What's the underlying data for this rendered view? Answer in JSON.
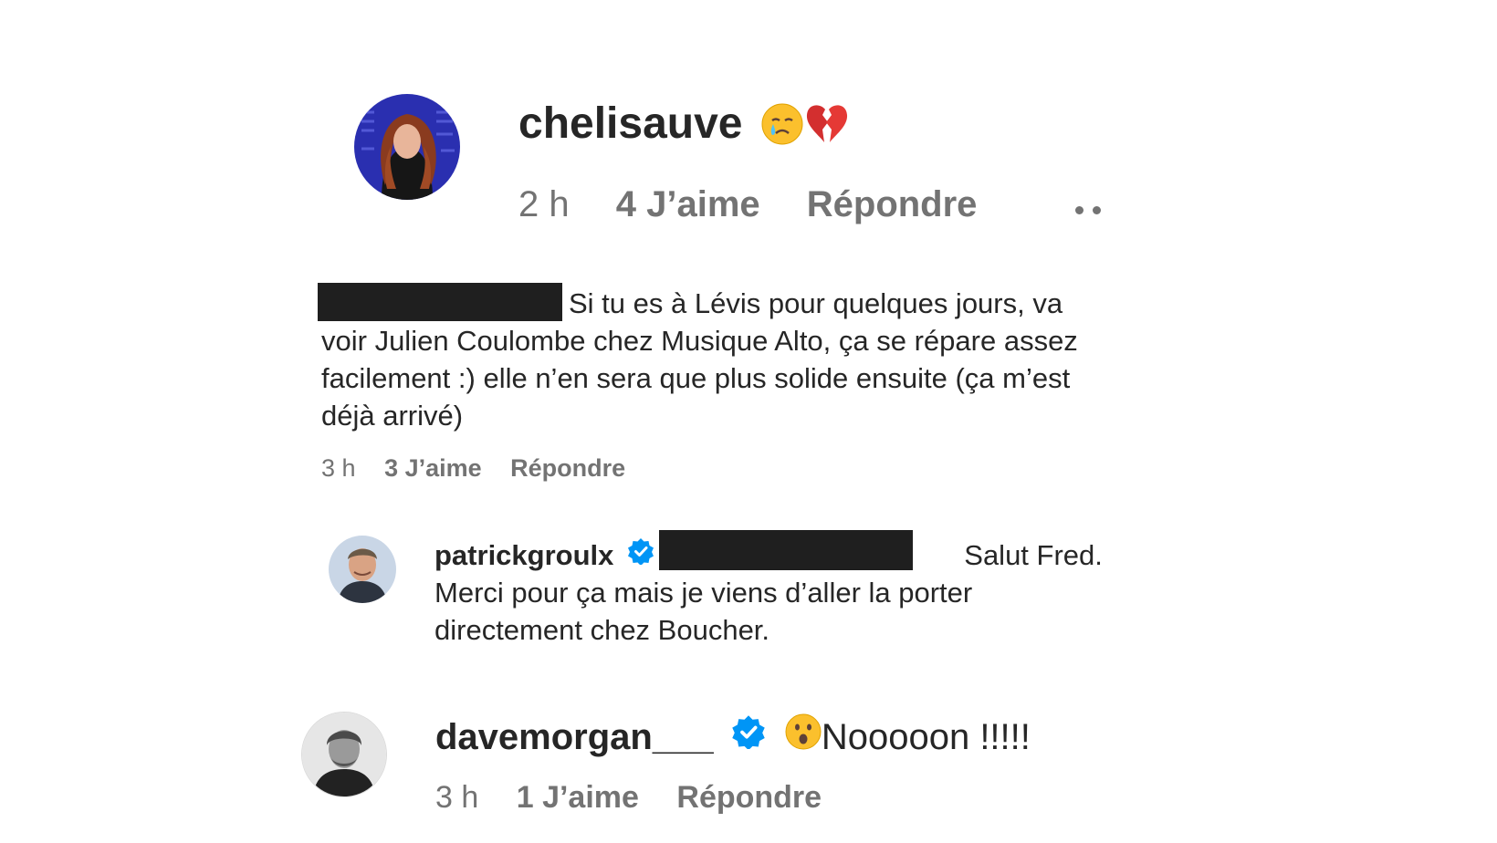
{
  "comments": [
    {
      "username": "chelisauve",
      "time": "2 h",
      "likes": "4 J’aime",
      "reply": "Répondre",
      "emoji": [
        "crying-face",
        "broken-heart"
      ]
    },
    {
      "text_line1": "Si tu es à Lévis pour quelques jours, va",
      "text_line2": "voir Julien Coulombe chez Musique Alto, ça se répare assez",
      "text_line3": "facilement :) elle n’en sera que plus solide ensuite (ça m’est",
      "text_line4": "déjà arrivé)",
      "time": "3 h",
      "likes": "3 J’aime",
      "reply": "Répondre"
    },
    {
      "username": "patrickgroulx",
      "text_line1": "Salut Fred.",
      "text_line2": "Merci pour ça mais je viens d’aller la porter",
      "text_line3": "directement chez Boucher."
    },
    {
      "username": "davemorgan___",
      "text": "Nooooon !!!!!",
      "time": "3 h",
      "likes": "1 J’aime",
      "reply": "Répondre",
      "emoji": "astonished-face"
    }
  ],
  "colors": {
    "text": "#262626",
    "meta": "#737373",
    "verified": "#0095f6",
    "redaction": "#1f1f1f"
  }
}
